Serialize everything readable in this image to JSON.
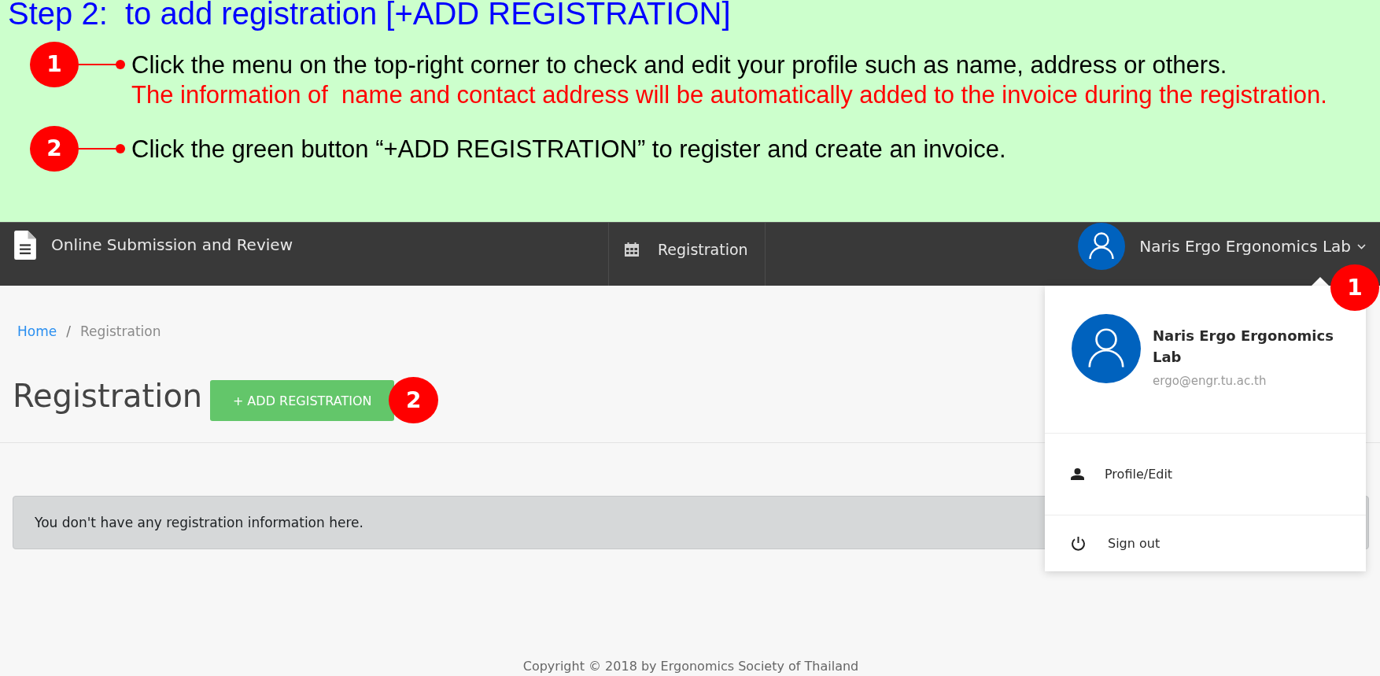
{
  "instructions": {
    "title": "Step 2:  to add registration [+ADD REGISTRATION]",
    "steps": [
      {
        "number": "1",
        "lines": [
          {
            "text": "Click the menu on the top-right corner to check and edit your profile such as name, address or others.",
            "kind": "plain"
          },
          {
            "text": "The information of  name and contact address will be automatically added to the invoice during the registration.",
            "kind": "note"
          }
        ]
      },
      {
        "number": "2",
        "lines": [
          {
            "text": "Click the green button “+ADD REGISTRATION” to register and create an invoice.",
            "kind": "plain"
          }
        ]
      }
    ]
  },
  "navbar": {
    "app_title": "Online Submission and Review",
    "nav_item": "Registration",
    "user_menu": {
      "name": "Naris Ergo Ergonomics Lab",
      "expanded": true,
      "callout": "1",
      "menu": {
        "name": "Naris Ergo Ergonomics Lab",
        "email": "ergo@engr.tu.ac.th",
        "items": [
          {
            "label": "Profile/Edit",
            "kind": "profile"
          },
          {
            "label": "Sign out",
            "kind": "sign_out"
          }
        ]
      }
    }
  },
  "breadcrumb": {
    "separator": "/",
    "items": [
      {
        "label": "Home",
        "kind": "link"
      },
      {
        "label": "Registration",
        "kind": "current"
      }
    ]
  },
  "page": {
    "title": "Registration",
    "add_button": {
      "label": "+ ADD REGISTRATION",
      "callout": "2"
    },
    "empty_message": "You don't have any registration information here."
  },
  "footer": "Copyright © 2018 by Ergonomics Society of Thailand"
}
